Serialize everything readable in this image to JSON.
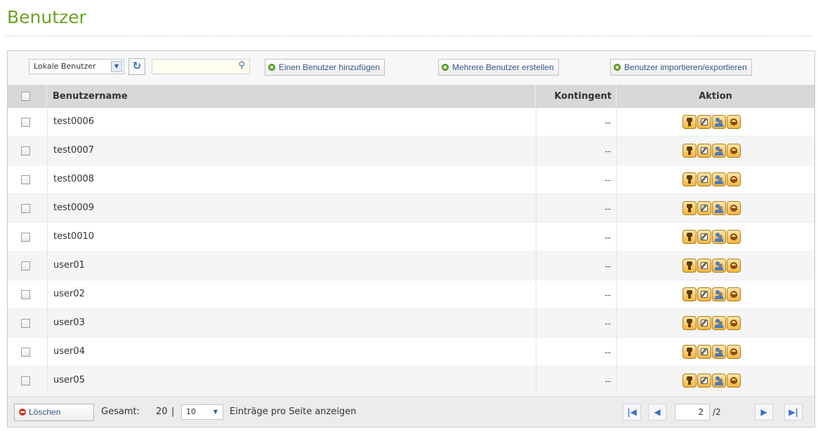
{
  "page": {
    "title": "Benutzer"
  },
  "toolbar": {
    "user_type_select": "Lokale Benutzer",
    "search_placeholder": "",
    "add_user": "Einen Benutzer hinzufügen",
    "create_multiple": "Mehrere Benutzer erstellen",
    "import_export": "Benutzer importieren/exportieren"
  },
  "table": {
    "columns": [
      "Benutzername",
      "Kontingent",
      "Aktion"
    ],
    "rows": [
      {
        "name": "test0006",
        "quota": "--"
      },
      {
        "name": "test0007",
        "quota": "--"
      },
      {
        "name": "test0008",
        "quota": "--"
      },
      {
        "name": "test0009",
        "quota": "--"
      },
      {
        "name": "test0010",
        "quota": "--"
      },
      {
        "name": "user01",
        "quota": "--"
      },
      {
        "name": "user02",
        "quota": "--"
      },
      {
        "name": "user03",
        "quota": "--"
      },
      {
        "name": "user04",
        "quota": "--"
      },
      {
        "name": "user05",
        "quota": "--"
      }
    ],
    "action_icons": [
      "password-icon",
      "edit-icon",
      "group-icon",
      "privilege-icon"
    ]
  },
  "footer": {
    "delete_label": "Löschen",
    "total_label": "Gesamt:",
    "total_value": "20",
    "separator": "|",
    "per_page_value": "10",
    "per_page_label": "Einträge pro Seite anzeigen",
    "current_page": "2",
    "total_pages": "/2"
  },
  "colors": {
    "title_green": "#6aa321",
    "header_bg": "#d8d8d8",
    "action_icon_bg": "#f2b63f"
  }
}
